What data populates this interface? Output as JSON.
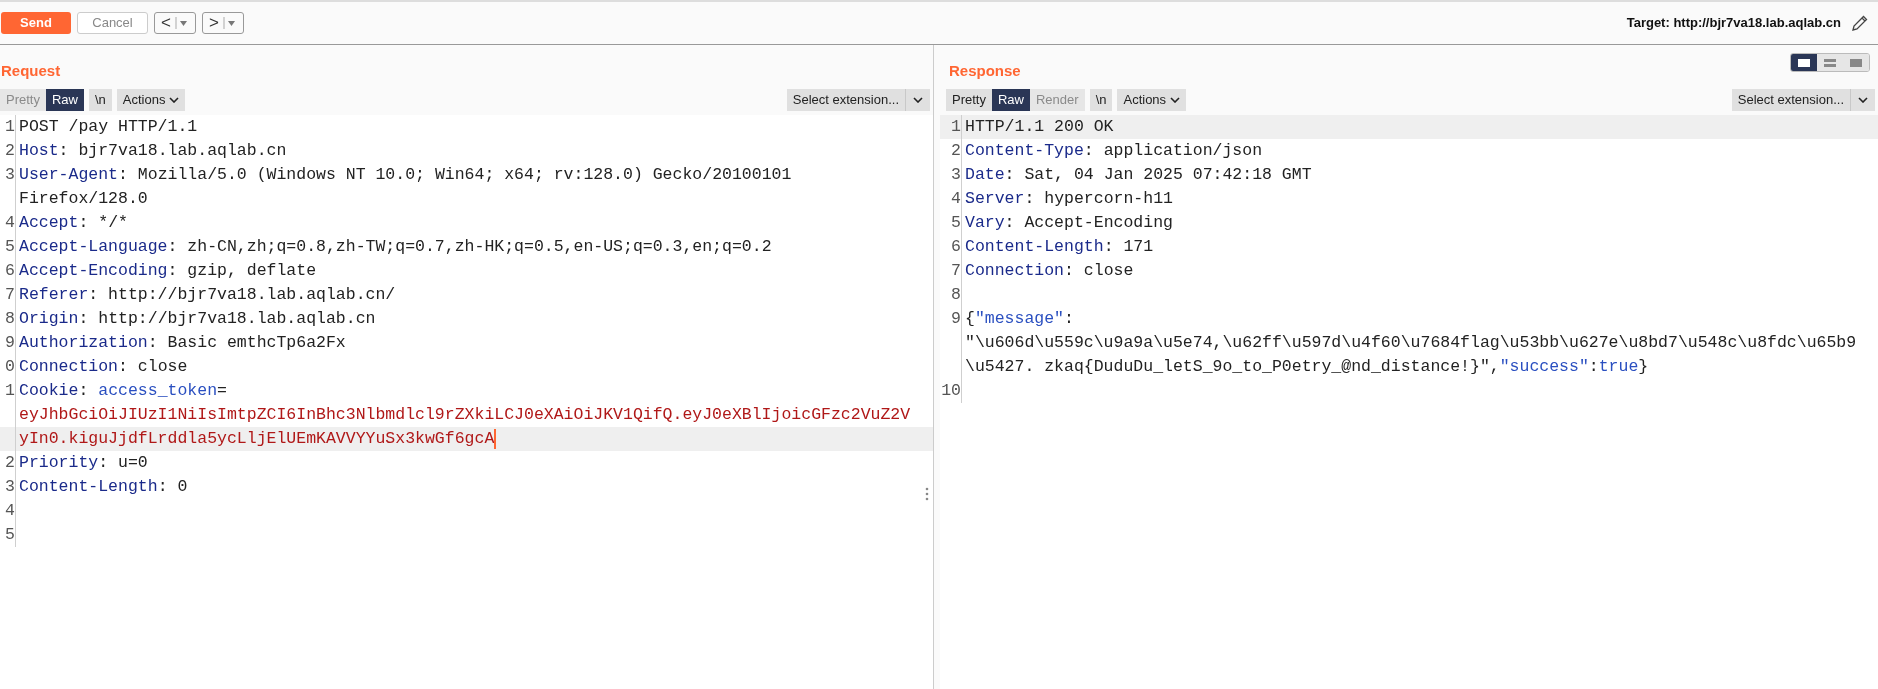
{
  "toolbar": {
    "send": "Send",
    "cancel": "Cancel",
    "back": "<",
    "forward": ">",
    "target": "Target: http://bjr7va18.lab.aqlab.cn"
  },
  "request": {
    "title": "Request",
    "tabs": [
      {
        "label": "Pretty",
        "selected": false,
        "disabled": true
      },
      {
        "label": "Raw",
        "selected": true,
        "disabled": false
      },
      {
        "label": "\\n",
        "selected": false,
        "disabled": false
      }
    ],
    "actions": "Actions",
    "extension": "Select extension...",
    "rows": [
      {
        "num": "1",
        "current": false,
        "spans": [
          {
            "kind": "plain",
            "text": "POST /pay HTTP/1.1"
          }
        ]
      },
      {
        "num": "2",
        "current": false,
        "spans": [
          {
            "kind": "key",
            "text": "Host"
          },
          {
            "kind": "plain",
            "text": ": bjr7va18.lab.aqlab.cn"
          }
        ]
      },
      {
        "num": "3",
        "current": false,
        "spans": [
          {
            "kind": "key",
            "text": "User-Agent"
          },
          {
            "kind": "plain",
            "text": ": Mozilla/5.0 (Windows NT 10.0; Win64; x64; rv:128.0) Gecko/20100101"
          }
        ]
      },
      {
        "current": false,
        "spans": [
          {
            "kind": "plain",
            "text": "Firefox/128.0"
          }
        ]
      },
      {
        "num": "4",
        "current": false,
        "spans": [
          {
            "kind": "key",
            "text": "Accept"
          },
          {
            "kind": "plain",
            "text": ": */*"
          }
        ]
      },
      {
        "num": "5",
        "current": false,
        "spans": [
          {
            "kind": "key",
            "text": "Accept-Language"
          },
          {
            "kind": "plain",
            "text": ": zh-CN,zh;q=0.8,zh-TW;q=0.7,zh-HK;q=0.5,en-US;q=0.3,en;q=0.2"
          }
        ]
      },
      {
        "num": "6",
        "current": false,
        "spans": [
          {
            "kind": "key",
            "text": "Accept-Encoding"
          },
          {
            "kind": "plain",
            "text": ": gzip, deflate"
          }
        ]
      },
      {
        "num": "7",
        "current": false,
        "spans": [
          {
            "kind": "key",
            "text": "Referer"
          },
          {
            "kind": "plain",
            "text": ": http://bjr7va18.lab.aqlab.cn/"
          }
        ]
      },
      {
        "num": "8",
        "current": false,
        "spans": [
          {
            "kind": "key",
            "text": "Origin"
          },
          {
            "kind": "plain",
            "text": ": http://bjr7va18.lab.aqlab.cn"
          }
        ]
      },
      {
        "num": "9",
        "current": false,
        "spans": [
          {
            "kind": "key",
            "text": "Authorization"
          },
          {
            "kind": "plain",
            "text": ": Basic emthcTp6a2Fx"
          }
        ]
      },
      {
        "num": "0",
        "current": false,
        "spans": [
          {
            "kind": "key",
            "text": "Connection"
          },
          {
            "kind": "plain",
            "text": ": close"
          }
        ]
      },
      {
        "num": "1",
        "current": false,
        "spans": [
          {
            "kind": "key",
            "text": "Cookie"
          },
          {
            "kind": "plain",
            "text": ": "
          },
          {
            "kind": "param",
            "text": "access_token"
          },
          {
            "kind": "plain",
            "text": "="
          }
        ]
      },
      {
        "current": false,
        "spans": [
          {
            "kind": "cookie",
            "text": "eyJhbGciOiJIUzI1NiIsImtpZCI6InBhc3Nlbmdlcl9rZXkiLCJ0eXAiOiJKV1QifQ.eyJ0eXBlIjoicGFzc2VuZ2V"
          }
        ]
      },
      {
        "current": true,
        "spans": [
          {
            "kind": "cookie",
            "text": "yIn0.kiguJjdfLrddla5ycLljElUEmKAVVYYuSx3kwGf6gcA"
          }
        ]
      },
      {
        "num": "2",
        "current": false,
        "spans": [
          {
            "kind": "key",
            "text": "Priority"
          },
          {
            "kind": "plain",
            "text": ": u=0"
          }
        ]
      },
      {
        "num": "3",
        "current": false,
        "spans": [
          {
            "kind": "key",
            "text": "Content-Length"
          },
          {
            "kind": "plain",
            "text": ": 0"
          }
        ]
      },
      {
        "num": "4",
        "current": false,
        "spans": []
      },
      {
        "num": "5",
        "current": false,
        "spans": []
      }
    ]
  },
  "response": {
    "title": "Response",
    "tabs": [
      {
        "label": "Pretty",
        "selected": false,
        "disabled": false
      },
      {
        "label": "Raw",
        "selected": true,
        "disabled": false
      },
      {
        "label": "Render",
        "selected": false,
        "disabled": true
      },
      {
        "label": "\\n",
        "selected": false,
        "disabled": false
      }
    ],
    "actions": "Actions",
    "extension": "Select extension...",
    "rows": [
      {
        "num": "1",
        "current": true,
        "spans": [
          {
            "kind": "plain",
            "text": "HTTP/1.1 200 OK"
          }
        ]
      },
      {
        "num": "2",
        "current": false,
        "spans": [
          {
            "kind": "key",
            "text": "Content-Type"
          },
          {
            "kind": "plain",
            "text": ": application/json"
          }
        ]
      },
      {
        "num": "3",
        "current": false,
        "spans": [
          {
            "kind": "key",
            "text": "Date"
          },
          {
            "kind": "plain",
            "text": ": Sat, 04 Jan 2025 07:42:18 GMT"
          }
        ]
      },
      {
        "num": "4",
        "current": false,
        "spans": [
          {
            "kind": "key",
            "text": "Server"
          },
          {
            "kind": "plain",
            "text": ": hypercorn-h11"
          }
        ]
      },
      {
        "num": "5",
        "current": false,
        "spans": [
          {
            "kind": "key",
            "text": "Vary"
          },
          {
            "kind": "plain",
            "text": ": Accept-Encoding"
          }
        ]
      },
      {
        "num": "6",
        "current": false,
        "spans": [
          {
            "kind": "key",
            "text": "Content-Length"
          },
          {
            "kind": "plain",
            "text": ": 171"
          }
        ]
      },
      {
        "num": "7",
        "current": false,
        "spans": [
          {
            "kind": "key",
            "text": "Connection"
          },
          {
            "kind": "plain",
            "text": ": close"
          }
        ]
      },
      {
        "num": "8",
        "current": false,
        "spans": []
      },
      {
        "num": "9",
        "current": false,
        "spans": [
          {
            "kind": "plain",
            "text": "{"
          },
          {
            "kind": "param",
            "text": "\"message\""
          },
          {
            "kind": "plain",
            "text": ":"
          }
        ]
      },
      {
        "current": false,
        "spans": [
          {
            "kind": "plain",
            "text": "\"\\u606d\\u559c\\u9a9a\\u5e74,\\u62ff\\u597d\\u4f60\\u7684flag\\u53bb\\u627e\\u8bd7\\u548c\\u8fdc\\u65b9"
          }
        ]
      },
      {
        "current": false,
        "spans": [
          {
            "kind": "plain",
            "text": "\\u5427. zkaq{DuduDu_letS_9o_to_P0etry_@nd_distance!}\","
          },
          {
            "kind": "param",
            "text": "\"success\""
          },
          {
            "kind": "plain",
            "text": ":"
          },
          {
            "kind": "param",
            "text": "true"
          },
          {
            "kind": "plain",
            "text": "}"
          }
        ]
      },
      {
        "num": "10",
        "current": false,
        "spans": []
      }
    ]
  }
}
